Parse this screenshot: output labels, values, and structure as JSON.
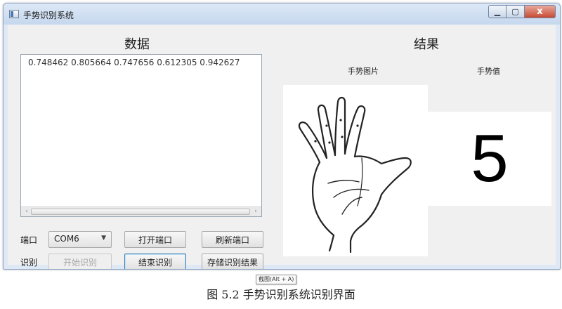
{
  "window": {
    "title": "手势识别系统",
    "close_glyph": "x"
  },
  "data_panel": {
    "title": "数据",
    "values_text": "0.748462   0.805664   0.747656   0.612305   0.942627"
  },
  "controls": {
    "port_label": "端口",
    "port_value": "COM6",
    "open_port": "打开端口",
    "refresh_port": "刷新端口",
    "recognize_label": "识别",
    "start_recognize": "开始识别",
    "end_recognize": "结束识别",
    "save_result": "存储识别结果"
  },
  "result_panel": {
    "title": "结果",
    "image_header": "手势图片",
    "value_header": "手势值",
    "gesture_value": "5"
  },
  "overlay": {
    "tooltip": "截图(Alt + A)"
  },
  "caption": "图 5.2  手势识别系统识别界面",
  "colors": {
    "titlebar": "#c6d8ee",
    "close_button": "#c74a34",
    "focus_border": "#3c7fb1"
  }
}
